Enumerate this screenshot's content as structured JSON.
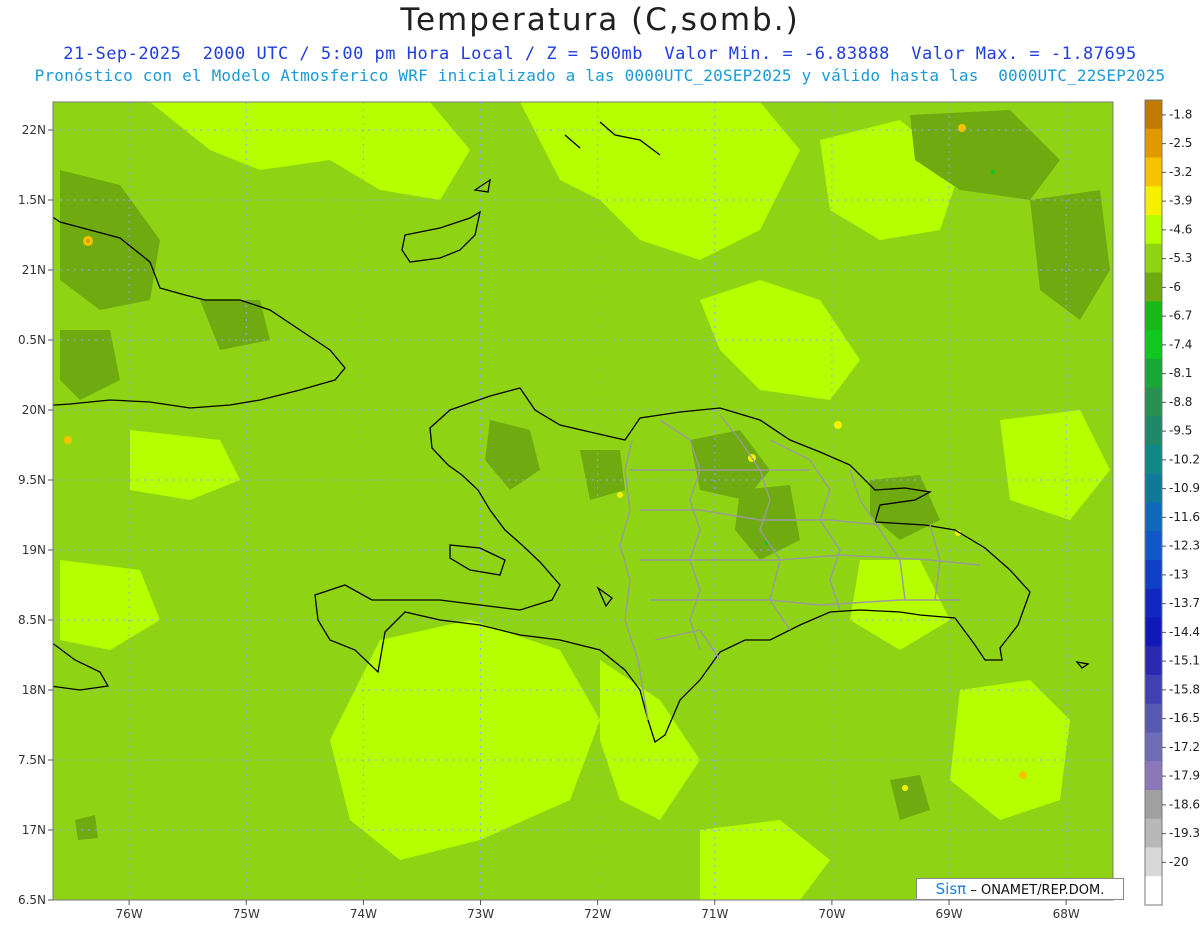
{
  "header": {
    "title": "Temperatura (C,somb.)",
    "line1": "21-Sep-2025  2000 UTC / 5:00 pm Hora Local / Z = 500mb  Valor Min. = -6.83888  Valor Max. = -1.87695",
    "line2": "Pronóstico con el Modelo Atmosferico WRF inicializado a las 0000UTC_20SEP2025 y válido hasta las  0000UTC_22SEP2025"
  },
  "map": {
    "lat_range": [
      16.5,
      22.2
    ],
    "lon_range": [
      -76.65,
      -67.6
    ],
    "lat_ticks": [
      "22N",
      "1.5N",
      "21N",
      "0.5N",
      "20N",
      "9.5N",
      "19N",
      "8.5N",
      "18N",
      "7.5N",
      "17N",
      "6.5N"
    ],
    "lon_ticks": [
      "76W",
      "75W",
      "74W",
      "73W",
      "72W",
      "71W",
      "70W",
      "69W",
      "68W"
    ],
    "gridline_color": "#9aa0ff"
  },
  "colorbar": {
    "labels": [
      "-1.8",
      "-2.5",
      "-3.2",
      "-3.9",
      "-4.6",
      "-5.3",
      "-6",
      "-6.7",
      "-7.4",
      "-8.1",
      "-8.8",
      "-9.5",
      "-10.2",
      "-10.9",
      "-11.6",
      "-12.3",
      "-13",
      "-13.7",
      "-14.4",
      "-15.1",
      "-15.8",
      "-16.5",
      "-17.2",
      "-17.9",
      "-18.6",
      "-19.3",
      "-20"
    ],
    "colors": [
      "#c07a00",
      "#e09a00",
      "#f7c200",
      "#f5f000",
      "#b5ff00",
      "#8ed414",
      "#6eaa10",
      "#18b818",
      "#10c820",
      "#18a838",
      "#289050",
      "#208868",
      "#108888",
      "#107898",
      "#1068b8",
      "#1058c8",
      "#1040c8",
      "#1028c0",
      "#1018b8",
      "#2828b0",
      "#4040b0",
      "#5858b0",
      "#6e6eb8",
      "#8c78b8",
      "#a0a0a0",
      "#b8b8b8",
      "#d8d8d8",
      "#ffffff"
    ]
  },
  "credit": {
    "brand": "Sisπ",
    "text": "– ONAMET/REP.DOM."
  }
}
